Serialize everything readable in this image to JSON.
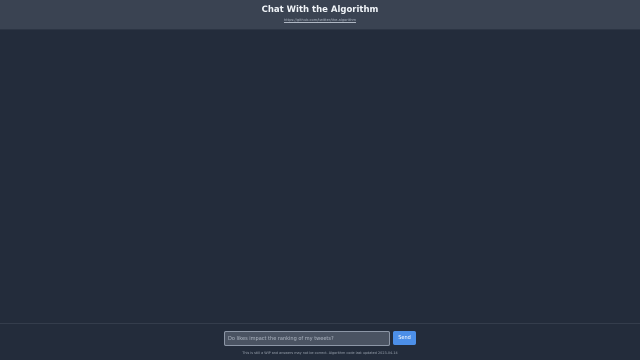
{
  "header": {
    "title": "Chat With the Algorithm",
    "link": "https://github.com/twitter/the-algorithm"
  },
  "chat": {
    "messages": []
  },
  "composer": {
    "placeholder": "Do likes impact the ranking of my tweets?",
    "value": "",
    "send_label": "Send"
  },
  "footer": {
    "note": "This is still a WIP and answers may not be correct. Algorithm code last updated 2023-04-14"
  },
  "colors": {
    "background": "#232c3b",
    "header": "#3a4352",
    "accent": "#4c8fe8"
  }
}
